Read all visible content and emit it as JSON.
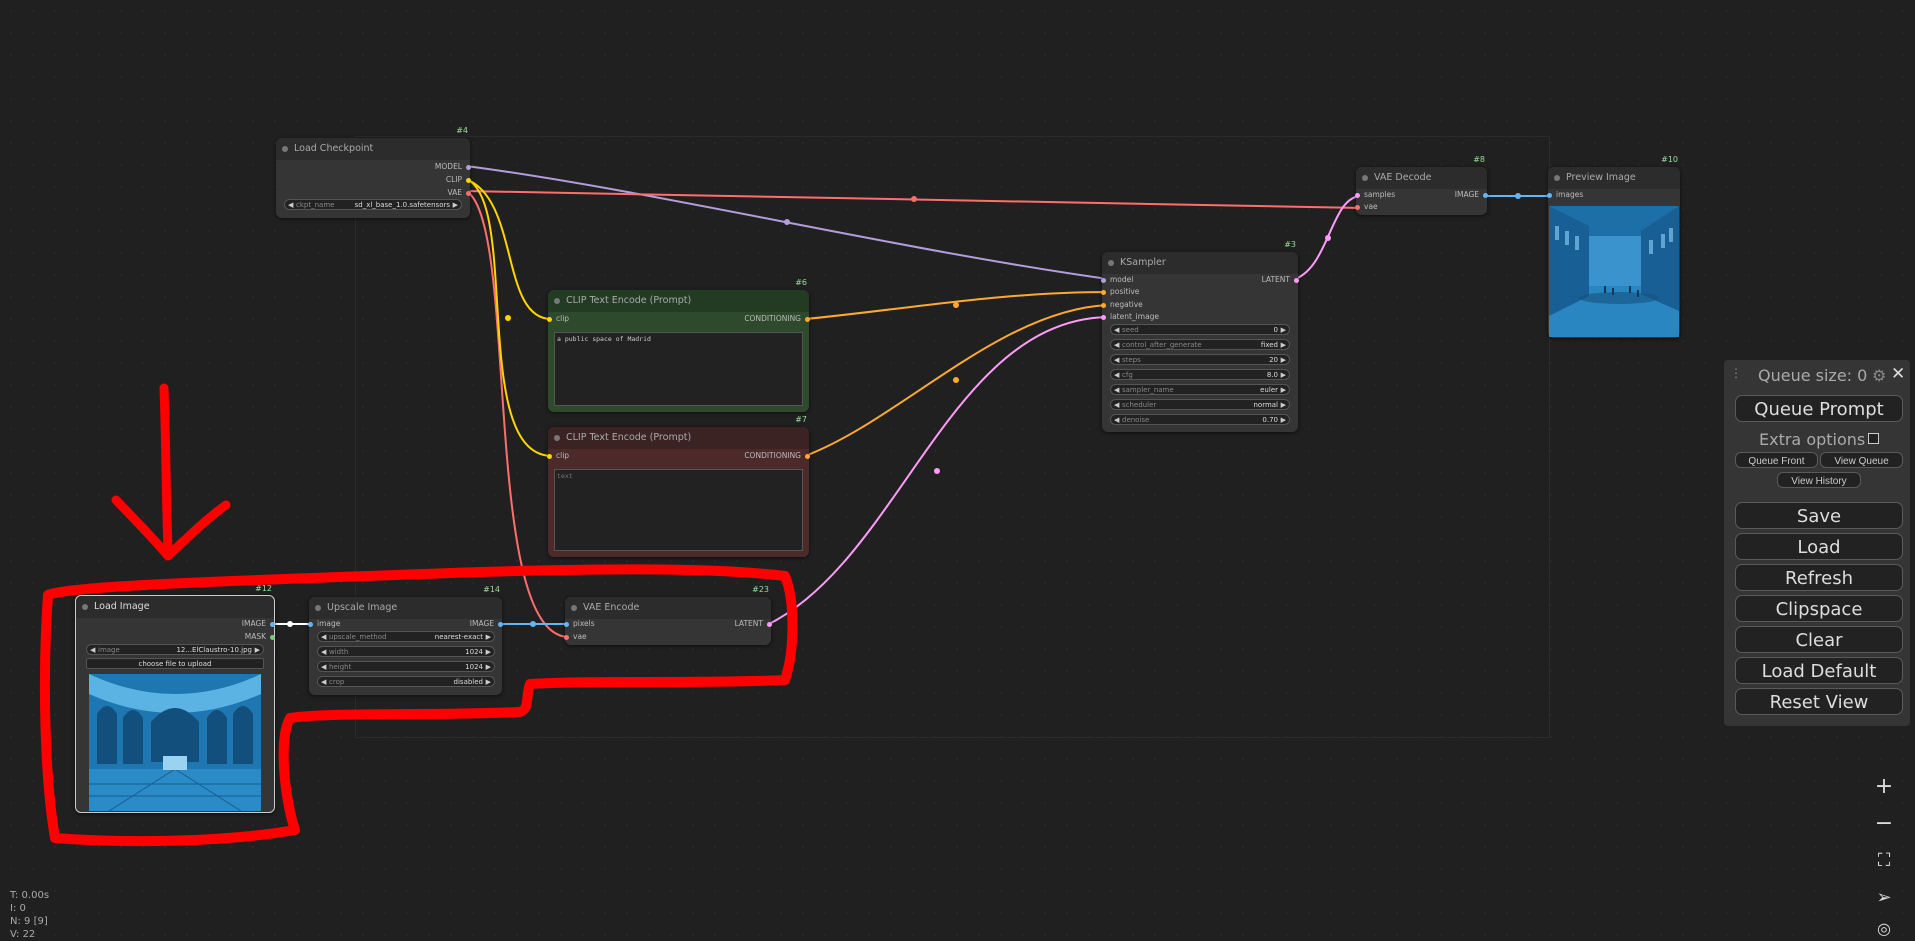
{
  "nodes": {
    "load_checkpoint": {
      "id": "#4",
      "title": "Load Checkpoint",
      "outputs": [
        "MODEL",
        "CLIP",
        "VAE"
      ],
      "widget": {
        "label": "ckpt_name",
        "value": "sd_xl_base_1.0.safetensors"
      }
    },
    "clip_pos": {
      "id": "#6",
      "title": "CLIP Text Encode (Prompt)",
      "input": "clip",
      "output": "CONDITIONING",
      "text": "a public space of Madrid"
    },
    "clip_neg": {
      "id": "#7",
      "title": "CLIP Text Encode (Prompt)",
      "input": "clip",
      "output": "CONDITIONING",
      "placeholder": "text"
    },
    "ksampler": {
      "id": "#3",
      "title": "KSampler",
      "inputs": [
        "model",
        "positive",
        "negative",
        "latent_image"
      ],
      "output": "LATENT",
      "widgets": [
        {
          "label": "seed",
          "value": "0"
        },
        {
          "label": "control_after_generate",
          "value": "fixed"
        },
        {
          "label": "steps",
          "value": "20"
        },
        {
          "label": "cfg",
          "value": "8.0"
        },
        {
          "label": "sampler_name",
          "value": "euler"
        },
        {
          "label": "scheduler",
          "value": "normal"
        },
        {
          "label": "denoise",
          "value": "0.70"
        }
      ]
    },
    "vae_decode": {
      "id": "#8",
      "title": "VAE Decode",
      "inputs": [
        "samples",
        "vae"
      ],
      "output": "IMAGE"
    },
    "preview_image": {
      "id": "#10",
      "title": "Preview Image",
      "input": "images"
    },
    "load_image": {
      "id": "#12",
      "title": "Load Image",
      "outputs": [
        "IMAGE",
        "MASK"
      ],
      "widget": {
        "label": "image",
        "value": "12...ElClaustro-10.jpg"
      },
      "upload_label": "choose file to upload"
    },
    "upscale_image": {
      "id": "#14",
      "title": "Upscale Image",
      "input": "image",
      "output": "IMAGE",
      "widgets": [
        {
          "label": "upscale_method",
          "value": "nearest-exact"
        },
        {
          "label": "width",
          "value": "1024"
        },
        {
          "label": "height",
          "value": "1024"
        },
        {
          "label": "crop",
          "value": "disabled"
        }
      ]
    },
    "vae_encode": {
      "id": "#23",
      "title": "VAE Encode",
      "inputs": [
        "pixels",
        "vae"
      ],
      "output": "LATENT"
    }
  },
  "menu": {
    "queue_size": "Queue size: 0",
    "queue_prompt": "Queue Prompt",
    "extra_options": "Extra options",
    "queue_front": "Queue Front",
    "view_queue": "View Queue",
    "view_history": "View History",
    "save": "Save",
    "load": "Load",
    "refresh": "Refresh",
    "clipspace": "Clipspace",
    "clear": "Clear",
    "load_default": "Load Default",
    "reset_view": "Reset View"
  },
  "stats": {
    "t": "T: 0.00s",
    "i": "I: 0",
    "n": "N: 9 [9]",
    "v": "V: 22"
  },
  "colors": {
    "model": "#b39ddb",
    "clip": "#ffd500",
    "vae": "#ff6e6e",
    "conditioning": "#ffa931",
    "latent": "#ff9cf9",
    "image": "#64b5f6",
    "annotation": "#ff0000"
  },
  "icons": [
    "settings-gear-icon",
    "close-icon",
    "zoom-in-icon",
    "zoom-out-icon",
    "fit-view-icon",
    "navigate-icon"
  ]
}
